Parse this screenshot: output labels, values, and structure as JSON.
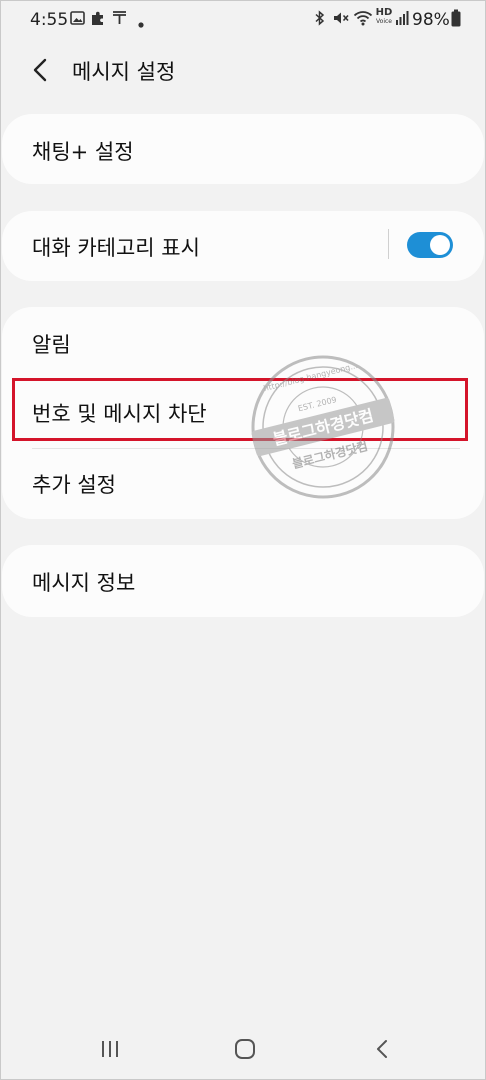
{
  "status_bar": {
    "time": "4:55",
    "battery": "98%",
    "left_icons": [
      "gallery-icon",
      "puzzle-icon",
      "t-icon",
      "dot-icon"
    ],
    "right_icons": [
      "bluetooth-icon",
      "mute-icon",
      "wifi-icon",
      "hd-voice-icon",
      "signal-icon",
      "battery-icon"
    ],
    "hd_top": "HD",
    "hd_bottom": "Voice"
  },
  "header": {
    "title": "메시지 설정"
  },
  "settings": {
    "chat_plus": "채팅+ 설정",
    "conversation_category": "대화 카테고리 표시",
    "conversation_category_enabled": true,
    "notifications": "알림",
    "block_numbers": "번호 및 메시지 차단",
    "more_settings": "추가 설정",
    "about_messages": "메시지 정보"
  },
  "watermark": {
    "top_text": "http://blog.hangyeong...",
    "center_text": "블로그하경닷컴",
    "est": "EST. 2009",
    "bottom_text": "블로그하경닷컴"
  },
  "colors": {
    "accent": "#1e8fd6",
    "highlight": "#d4142a",
    "background": "#f2f2f2",
    "card": "#fcfcfc"
  },
  "nav": {
    "icons": [
      "recents-icon",
      "home-icon",
      "back-icon"
    ]
  }
}
